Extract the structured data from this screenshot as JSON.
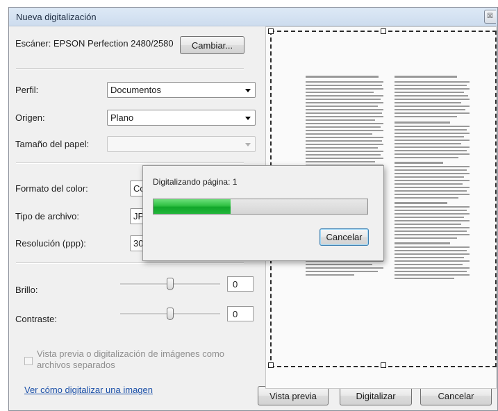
{
  "window": {
    "title": "Nueva digitalización"
  },
  "scanner": {
    "label": "Escáner: EPSON Perfection 2480/2580",
    "change_button": "Cambiar..."
  },
  "profile": {
    "label": "Perfil:",
    "value": "Documentos"
  },
  "source": {
    "label": "Origen:",
    "value": "Plano"
  },
  "paper_size": {
    "label": "Tamaño del papel:",
    "value": ""
  },
  "color_format": {
    "label": "Formato del color:",
    "value": "Co"
  },
  "file_type": {
    "label": "Tipo de archivo:",
    "value": "JP"
  },
  "resolution": {
    "label": "Resolución (ppp):",
    "value": "30"
  },
  "brightness": {
    "label": "Brillo:",
    "value": "0",
    "level": 0.5
  },
  "contrast": {
    "label": "Contraste:",
    "value": "0",
    "level": 0.5
  },
  "separate_files": {
    "label": "Vista previa o digitalización de imágenes como archivos separados",
    "checked": false
  },
  "help_link": "Ver cómo digitalizar una imagen",
  "actions": {
    "preview": "Vista previa",
    "scan": "Digitalizar",
    "cancel": "Cancelar"
  },
  "progress": {
    "status": "Digitalizando página: 1",
    "fraction": 0.36,
    "cancel": "Cancelar"
  },
  "colors": {
    "accent_green": "#1fb339",
    "link_blue": "#1a4fa8",
    "title_bar": "#d6e3f2"
  }
}
